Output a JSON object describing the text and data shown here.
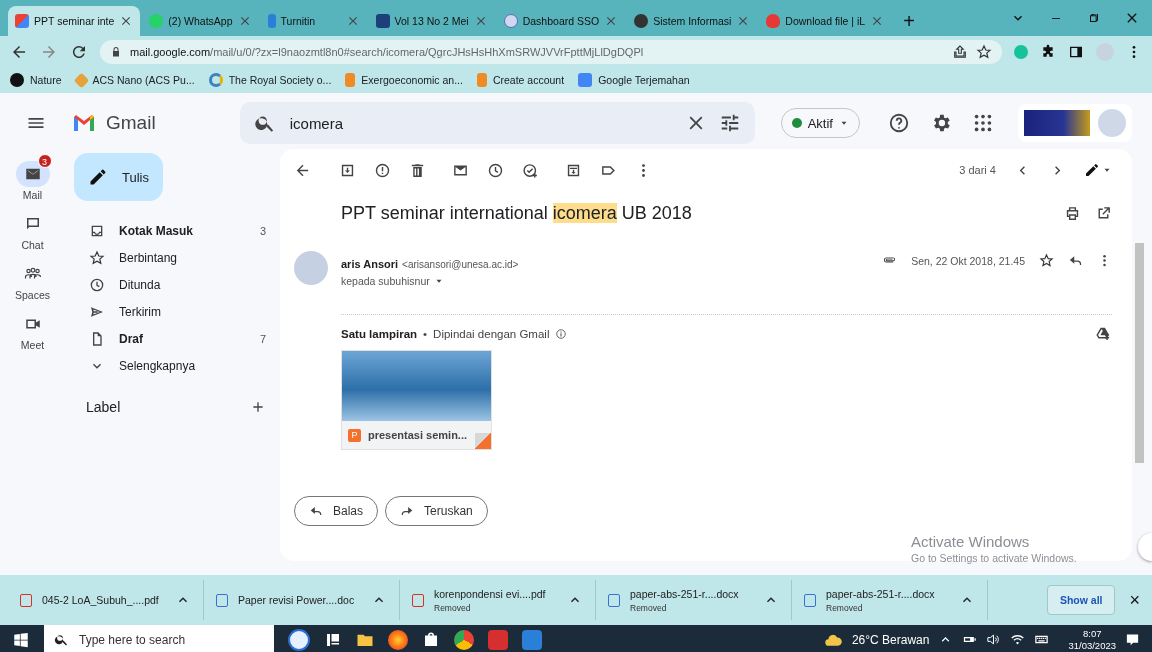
{
  "browser": {
    "tabs": [
      {
        "title": "PPT seminar inte",
        "selected": true
      },
      {
        "title": "(2) WhatsApp",
        "selected": false
      },
      {
        "title": "Turnitin",
        "selected": false
      },
      {
        "title": "Vol 13 No 2 Mei",
        "selected": false
      },
      {
        "title": "Dashboard SSO",
        "selected": false
      },
      {
        "title": "Sistem Informasi",
        "selected": false
      },
      {
        "title": "Download file | iL",
        "selected": false
      }
    ],
    "new_tab": "+",
    "address": {
      "host": "mail.google.com",
      "path": "/mail/u/0/?zx=l9naozmtl8n0#search/icomera/QgrcJHsHsHhXmSRWJVVrFpttMjLlDgDQPl"
    },
    "bookmarks": [
      {
        "label": "Nature"
      },
      {
        "label": "ACS Nano (ACS Pu..."
      },
      {
        "label": "The Royal Society o..."
      },
      {
        "label": "Exergoeconomic an..."
      },
      {
        "label": "Create account"
      },
      {
        "label": "Google Terjemahan"
      }
    ]
  },
  "gmail": {
    "logo": "Gmail",
    "search": {
      "value": "icomera"
    },
    "status": {
      "label": "Aktif",
      "color": "#1e8e3e"
    },
    "rail": [
      {
        "label": "Mail",
        "badge": "3",
        "selected": true
      },
      {
        "label": "Chat",
        "selected": false
      },
      {
        "label": "Spaces",
        "selected": false
      },
      {
        "label": "Meet",
        "selected": false
      }
    ],
    "compose": "Tulis",
    "folders": [
      {
        "label": "Kotak Masuk",
        "count": "3",
        "bold": true
      },
      {
        "label": "Berbintang",
        "bold": false
      },
      {
        "label": "Ditunda",
        "bold": false
      },
      {
        "label": "Terkirim",
        "bold": false
      },
      {
        "label": "Draf",
        "count": "7",
        "bold": true
      },
      {
        "label": "Selengkapnya",
        "bold": false
      }
    ],
    "label_heading": "Label",
    "pager": "3 dari 4",
    "message": {
      "subject_before": "PPT seminar international ",
      "subject_highlight": "icomera",
      "subject_after": " UB 2018",
      "sender": "aris Ansori",
      "email": "<arisansori@unesa.ac.id>",
      "recipient": "kepada subuhisnur",
      "date": "Sen, 22 Okt 2018, 21.45",
      "attachments_title": "Satu lampiran",
      "separator": "•",
      "scanned": "Dipindai dengan Gmail",
      "attachment": {
        "name": "presentasi semin...",
        "type_letter": "P"
      },
      "actions": [
        "Balas",
        "Teruskan"
      ]
    }
  },
  "os_notice": {
    "title": "Activate Windows",
    "subtitle": "Go to Settings to activate Windows."
  },
  "downloads": {
    "items": [
      {
        "name": "045-2 LoA_Subuh_....pdf",
        "kind": "pdf"
      },
      {
        "name": "Paper revisi Power....doc",
        "kind": "doc"
      },
      {
        "name": "korenpondensi evi....pdf",
        "kind": "pdf",
        "status": "Removed"
      },
      {
        "name": "paper-abs-251-r....docx",
        "kind": "doc",
        "status": "Removed"
      },
      {
        "name": "paper-abs-251-r....docx",
        "kind": "doc",
        "status": "Removed"
      }
    ],
    "show_all": "Show all",
    "close": "×"
  },
  "taskbar": {
    "search_placeholder": "Type here to search",
    "weather": "26°C Berawan",
    "time": "8:07",
    "date": "31/03/2023"
  }
}
